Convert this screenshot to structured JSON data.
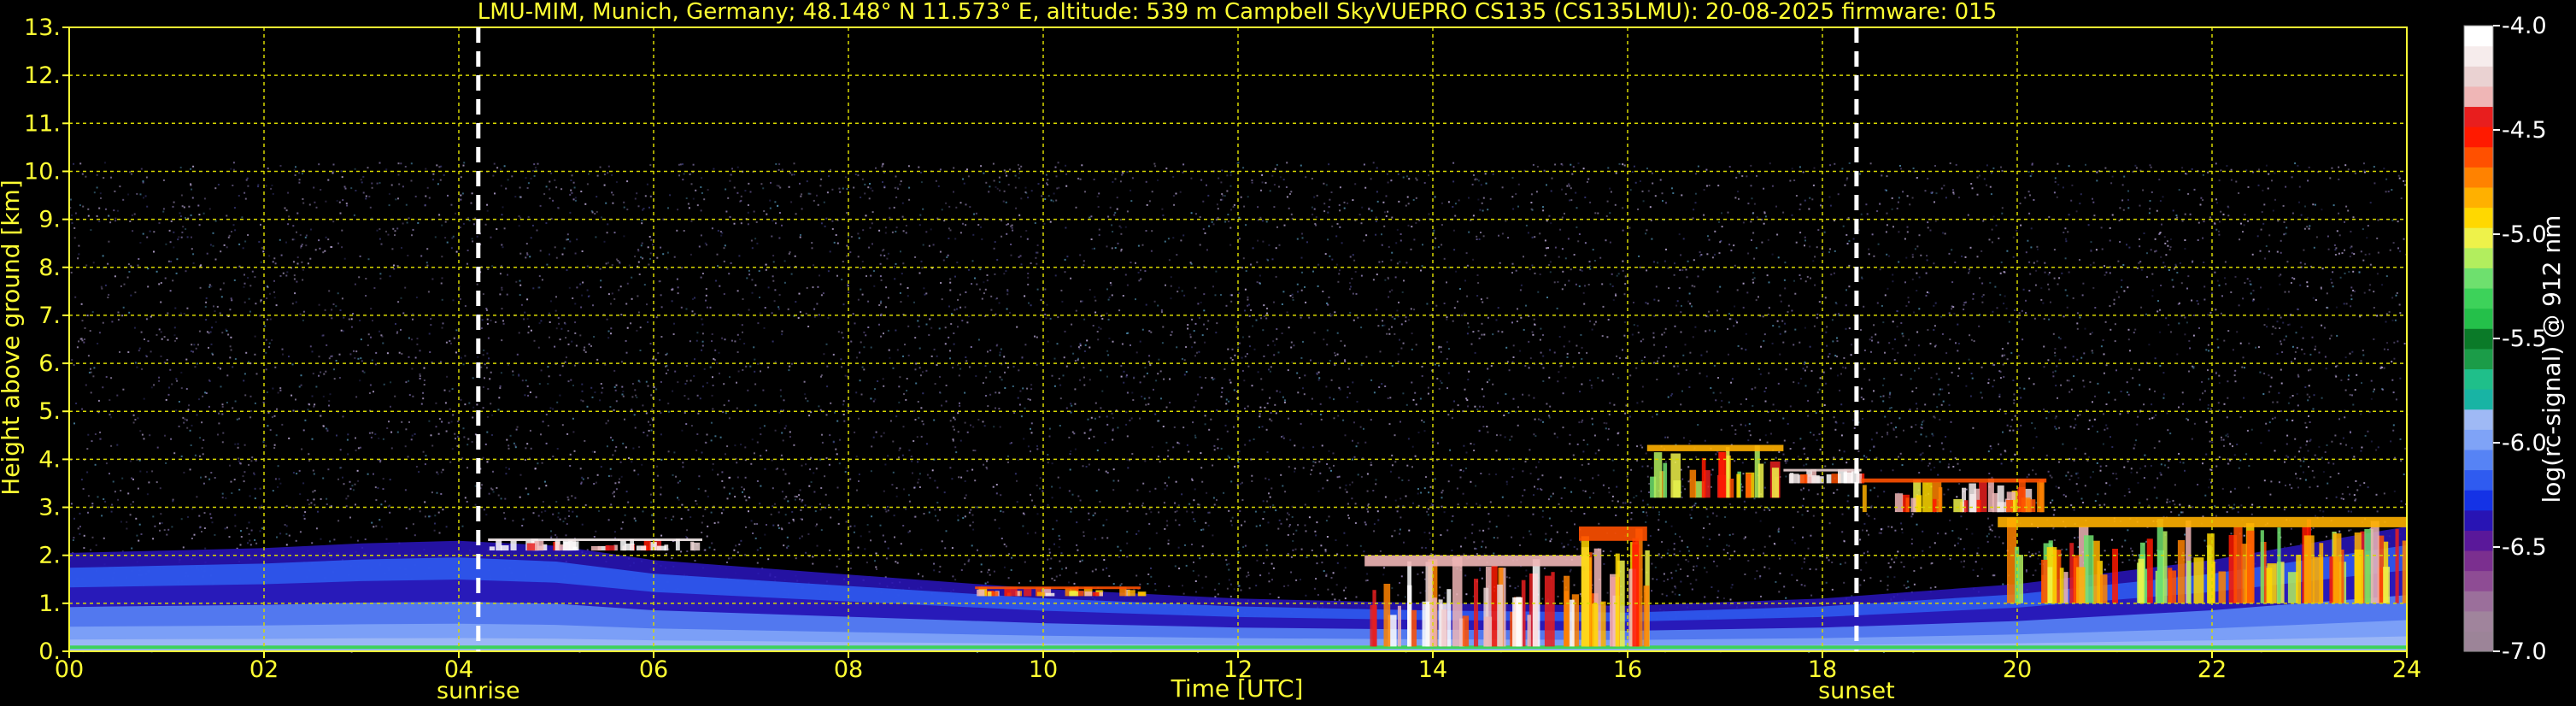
{
  "chart_data": {
    "type": "heatmap",
    "title": "LMU-MIM, Munich, Germany; 48.148° N 11.573° E, altitude: 539 m    Campbell SkyVUEPRO CS135 (CS135LMU): 20-08-2025    firmware: 015",
    "xlabel": "Time [UTC]",
    "ylabel": "Height above ground [km]",
    "xlim": [
      0,
      24
    ],
    "ylim": [
      0,
      13
    ],
    "x_ticks": [
      "00",
      "02",
      "04",
      "06",
      "08",
      "10",
      "12",
      "14",
      "16",
      "18",
      "20",
      "22",
      "24"
    ],
    "y_ticks": [
      "0.",
      "1.",
      "2.",
      "3.",
      "4.",
      "5.",
      "6.",
      "7.",
      "8.",
      "9.",
      "10.",
      "11.",
      "12.",
      "13."
    ],
    "grid": true,
    "colorbar": {
      "label": "log(rc-signal) @ 912 nm",
      "range": [
        -7.0,
        -4.0
      ],
      "ticks": [
        "-4.0",
        "-4.5",
        "-5.0",
        "-5.5",
        "-6.0",
        "-6.5",
        "-7.0"
      ],
      "colors": [
        "#9c8498",
        "#a0849c",
        "#9b6f9b",
        "#8e4c94",
        "#7b2f8f",
        "#5a189a",
        "#2814b4",
        "#1432e6",
        "#2f5bf0",
        "#5683f5",
        "#7fa3f7",
        "#9fb9f5",
        "#18b4a4",
        "#1fbf8a",
        "#1b9c48",
        "#0a7a28",
        "#24c04a",
        "#3dd25a",
        "#6ee06e",
        "#b2ee5e",
        "#eef24a",
        "#ffd800",
        "#ffb000",
        "#ff8200",
        "#ff5000",
        "#ff1a00",
        "#e81e1e",
        "#efb6b6",
        "#ead2d2",
        "#f6ecec",
        "#ffffff"
      ]
    },
    "markers": [
      {
        "label": "sunrise",
        "x": 4.2
      },
      {
        "label": "sunset",
        "x": 18.35
      }
    ],
    "signal_top_km": 10.2,
    "boundary_layer": [
      {
        "x": 0,
        "y": 2.05
      },
      {
        "x": 1,
        "y": 2.1
      },
      {
        "x": 2,
        "y": 2.15
      },
      {
        "x": 3,
        "y": 2.25
      },
      {
        "x": 4,
        "y": 2.3
      },
      {
        "x": 5,
        "y": 2.2
      },
      {
        "x": 6,
        "y": 1.9
      },
      {
        "x": 8,
        "y": 1.6
      },
      {
        "x": 10,
        "y": 1.3
      },
      {
        "x": 12,
        "y": 1.1
      },
      {
        "x": 14,
        "y": 1.0
      },
      {
        "x": 16,
        "y": 0.95
      },
      {
        "x": 18,
        "y": 1.1
      },
      {
        "x": 20,
        "y": 1.4
      },
      {
        "x": 22,
        "y": 1.9
      },
      {
        "x": 24,
        "y": 2.6
      }
    ],
    "cloud_layers": [
      {
        "x": [
          4.3,
          6.5
        ],
        "y": [
          2.1,
          2.35
        ],
        "value": -4.1
      },
      {
        "x": [
          9.3,
          11.0
        ],
        "y": [
          1.15,
          1.35
        ],
        "value": -4.6
      },
      {
        "x": [
          13.3,
          15.6
        ],
        "y": [
          0.1,
          2.0
        ],
        "value": -4.3
      },
      {
        "x": [
          15.5,
          16.2
        ],
        "y": [
          0.1,
          2.6
        ],
        "value": -4.6
      },
      {
        "x": [
          16.2,
          17.6
        ],
        "y": [
          3.2,
          4.3
        ],
        "value": -4.8
      },
      {
        "x": [
          17.6,
          18.4
        ],
        "y": [
          3.5,
          3.8
        ],
        "value": -4.2
      },
      {
        "x": [
          18.4,
          20.3
        ],
        "y": [
          2.9,
          3.6
        ],
        "value": -4.6
      },
      {
        "x": [
          19.8,
          24.0
        ],
        "y": [
          1.0,
          2.8
        ],
        "value": -4.8
      }
    ]
  }
}
